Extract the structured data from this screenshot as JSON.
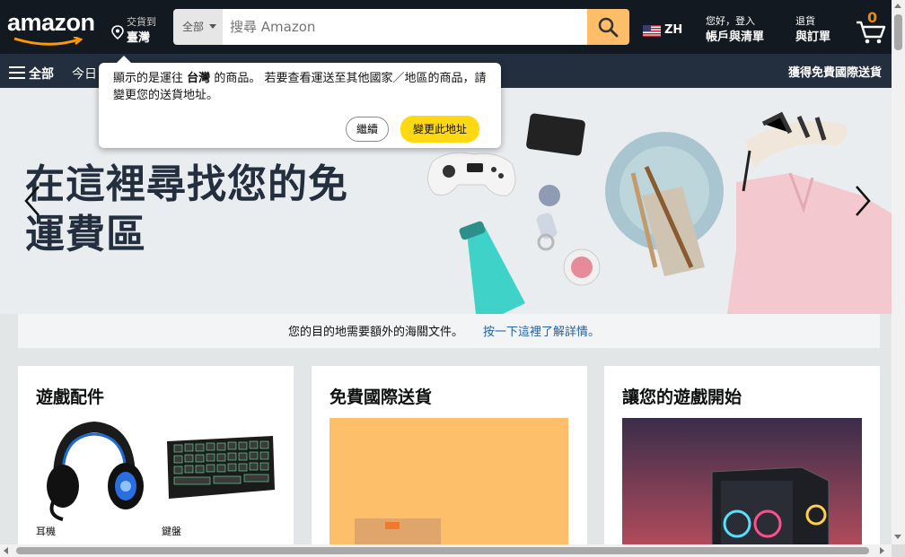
{
  "header": {
    "logo_text": "amazon",
    "deliver_line1": "交貨到",
    "deliver_line2": "臺灣",
    "search_category": "全部",
    "search_placeholder": "搜尋 Amazon",
    "language_code": "ZH",
    "account_line1": "您好，登入",
    "account_line2": "帳戶與清單",
    "orders_line1": "退貨",
    "orders_line2": "與訂單",
    "cart_count": "0"
  },
  "subnav": {
    "all_label": "全部",
    "today_label": "今日",
    "free_intl_label": "獲得免費國際送貨"
  },
  "popover": {
    "text_prefix": "顯示的是運往",
    "text_location": "台灣",
    "text_suffix": "的商品。 若要查看運送至其他國家／地區的商品，請變更您的送貨地址。",
    "continue_label": "繼續",
    "change_label": "變更此地址"
  },
  "hero": {
    "title_line1": "在這裡尋找您的免",
    "title_line2": "運費區"
  },
  "notice": {
    "text": "您的目的地需要額外的海關文件。",
    "link": "按一下這裡了解詳情。"
  },
  "cards": [
    {
      "title": "遊戲配件",
      "tiles": [
        {
          "caption": "耳機"
        },
        {
          "caption": "鍵盤"
        }
      ]
    },
    {
      "title": "免費國際送貨"
    },
    {
      "title": "讓您的遊戲開始"
    }
  ],
  "colors": {
    "nav_dark": "#131921",
    "nav_sub": "#232f3e",
    "search_button": "#febd69",
    "primary_button": "#ffd814",
    "link": "#2162a1",
    "cart_count": "#f08804"
  }
}
